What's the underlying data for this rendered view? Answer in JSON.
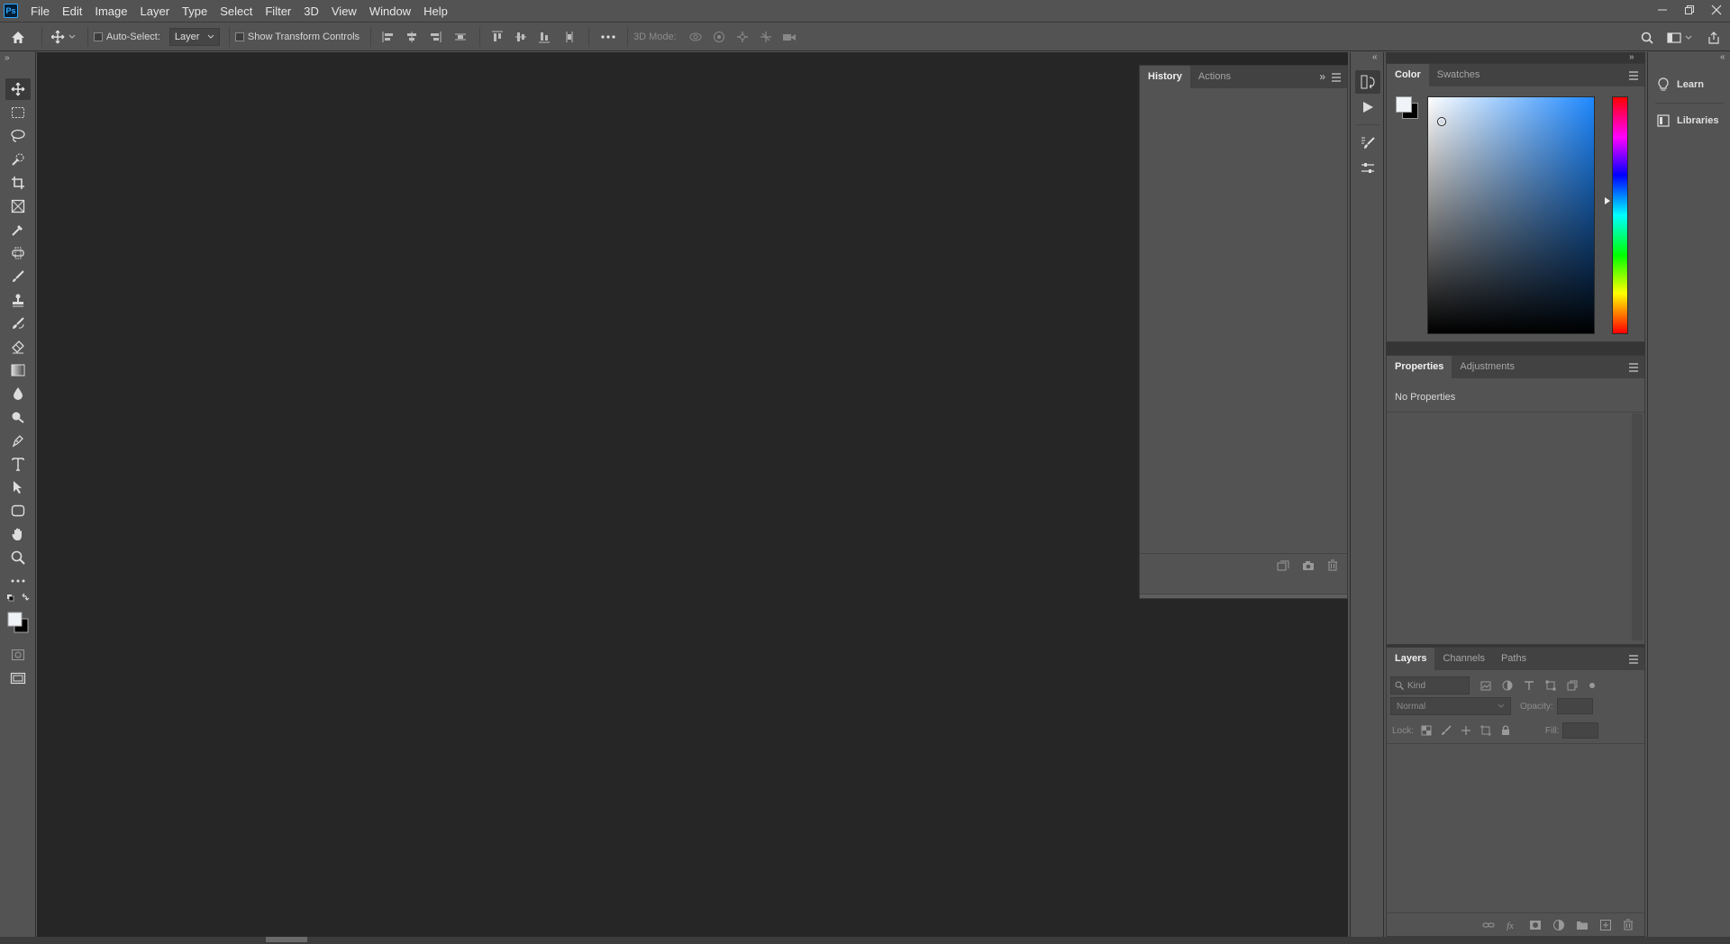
{
  "app": {
    "logo": "Ps"
  },
  "menu": [
    "File",
    "Edit",
    "Image",
    "Layer",
    "Type",
    "Select",
    "Filter",
    "3D",
    "View",
    "Window",
    "Help"
  ],
  "options": {
    "auto_select_label": "Auto-Select:",
    "auto_select_target": "Layer",
    "show_transform_label": "Show Transform Controls",
    "mode_3d_label": "3D Mode:"
  },
  "history_panel": {
    "tabs": [
      "History",
      "Actions"
    ],
    "active_tab": "History"
  },
  "color_panel": {
    "tabs": [
      "Color",
      "Swatches"
    ],
    "active_tab": "Color",
    "foreground": "#f0f4f8",
    "background": "#000000"
  },
  "properties_panel": {
    "tabs": [
      "Properties",
      "Adjustments"
    ],
    "active_tab": "Properties",
    "empty_text": "No Properties"
  },
  "layers_panel": {
    "tabs": [
      "Layers",
      "Channels",
      "Paths"
    ],
    "active_tab": "Layers",
    "filter_placeholder": "Kind",
    "blend_mode": "Normal",
    "opacity_label": "Opacity:",
    "lock_label": "Lock:",
    "fill_label": "Fill:"
  },
  "learn_column": {
    "items": [
      "Learn",
      "Libraries"
    ]
  },
  "colors": {
    "ui_bg": "#535353",
    "canvas_bg": "#262626",
    "panel_tab_bg": "#424242"
  }
}
